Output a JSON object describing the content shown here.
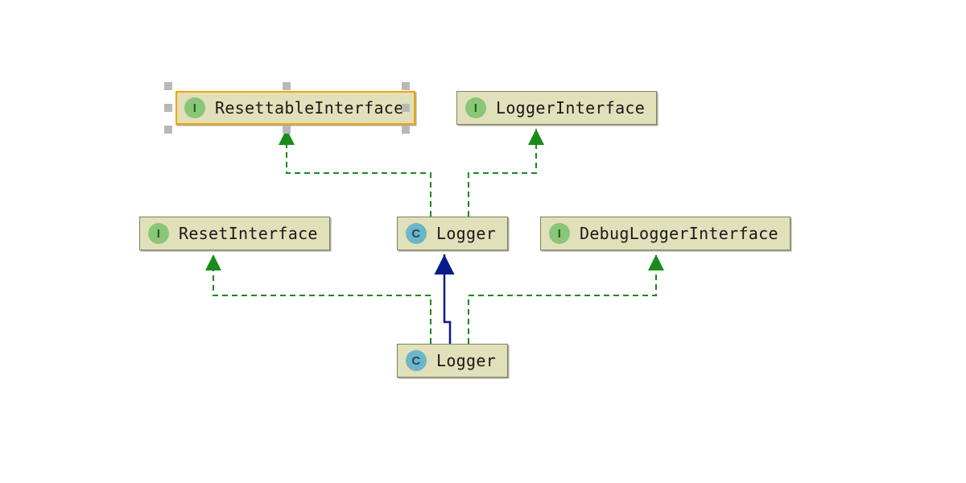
{
  "diagram": {
    "nodes": {
      "resettableInterface": {
        "label": "ResettableInterface",
        "kind": "I",
        "selected": true
      },
      "loggerInterface": {
        "label": "LoggerInterface",
        "kind": "I",
        "selected": false
      },
      "resetInterface": {
        "label": "ResetInterface",
        "kind": "I",
        "selected": false
      },
      "loggerMid": {
        "label": "Logger",
        "kind": "C",
        "selected": false
      },
      "debugLoggerInterface": {
        "label": "DebugLoggerInterface",
        "kind": "I",
        "selected": false
      },
      "loggerBottom": {
        "label": "Logger",
        "kind": "C",
        "selected": false
      }
    },
    "badgeLetters": {
      "I": "I",
      "C": "C"
    },
    "colors": {
      "nodeFill": "#e0e0ba",
      "nodeBorder": "#808060",
      "selectedBorder": "#f5a300",
      "interfaceBadge": "#89c678",
      "classBadge": "#6db6c9",
      "implementsArrow": "#1a8b1a",
      "extendsArrow": "#0a1a8a",
      "selectionHandle": "#b8b8b8"
    },
    "relationships": [
      {
        "from": "loggerMid",
        "to": "resettableInterface",
        "type": "implements"
      },
      {
        "from": "loggerMid",
        "to": "loggerInterface",
        "type": "implements"
      },
      {
        "from": "loggerBottom",
        "to": "resetInterface",
        "type": "implements"
      },
      {
        "from": "loggerBottom",
        "to": "debugLoggerInterface",
        "type": "implements"
      },
      {
        "from": "loggerBottom",
        "to": "loggerMid",
        "type": "extends"
      }
    ]
  }
}
